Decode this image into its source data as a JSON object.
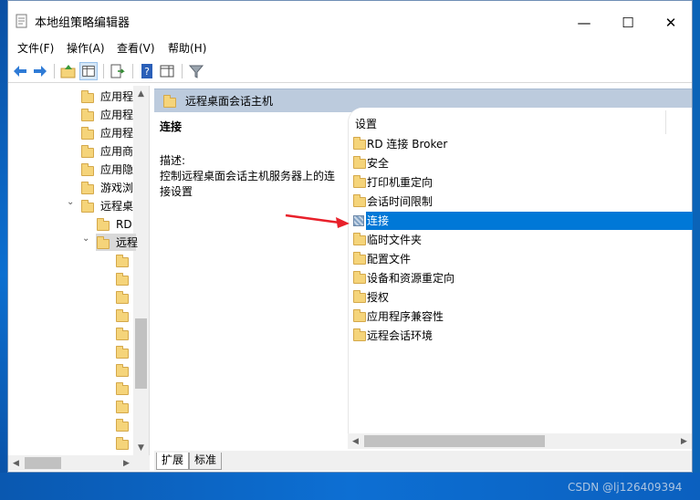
{
  "window": {
    "title": "本地组策略编辑器",
    "minimize_glyph": "—",
    "maximize_glyph": "☐",
    "close_glyph": "✕"
  },
  "menu": [
    "文件(F)",
    "操作(A)",
    "查看(V)",
    "帮助(H)"
  ],
  "toolbar": {
    "icons": [
      "back-icon",
      "forward-icon",
      "up-folder-icon",
      "show-hide-tree-icon",
      "export-list-icon",
      "help-icon",
      "show-hide-action-pane-icon",
      "filter-icon"
    ]
  },
  "tree": {
    "items": [
      {
        "label": "应用程",
        "indent": 1,
        "expand": ""
      },
      {
        "label": "应用程",
        "indent": 1,
        "expand": ""
      },
      {
        "label": "应用程",
        "indent": 1,
        "expand": ""
      },
      {
        "label": "应用商",
        "indent": 1,
        "expand": ""
      },
      {
        "label": "应用隐",
        "indent": 1,
        "expand": ""
      },
      {
        "label": "游戏浏",
        "indent": 1,
        "expand": ""
      },
      {
        "label": "远程桌",
        "indent": 1,
        "expand": "open"
      },
      {
        "label": "RD",
        "indent": 2,
        "expand": ""
      },
      {
        "label": "远程",
        "indent": 2,
        "expand": "open",
        "selected": true
      },
      {
        "label": "",
        "indent": 3,
        "expand": ""
      },
      {
        "label": "",
        "indent": 3,
        "expand": ""
      },
      {
        "label": "",
        "indent": 3,
        "expand": ""
      },
      {
        "label": "",
        "indent": 3,
        "expand": ""
      },
      {
        "label": "",
        "indent": 3,
        "expand": ""
      },
      {
        "label": "",
        "indent": 3,
        "expand": ""
      },
      {
        "label": "",
        "indent": 3,
        "expand": ""
      },
      {
        "label": "",
        "indent": 3,
        "expand": ""
      },
      {
        "label": "",
        "indent": 3,
        "expand": ""
      },
      {
        "label": "",
        "indent": 3,
        "expand": ""
      },
      {
        "label": "",
        "indent": 3,
        "expand": ""
      }
    ]
  },
  "pane": {
    "header": "远程桌面会话主机",
    "desc_title": "连接",
    "desc_label": "描述:",
    "desc_text": "控制远程桌面会话主机服务器上的连接设置",
    "column_header": "设置",
    "items": [
      {
        "label": "RD 连接 Broker",
        "selected": false
      },
      {
        "label": "安全",
        "selected": false
      },
      {
        "label": "打印机重定向",
        "selected": false
      },
      {
        "label": "会话时间限制",
        "selected": false
      },
      {
        "label": "连接",
        "selected": true
      },
      {
        "label": "临时文件夹",
        "selected": false
      },
      {
        "label": "配置文件",
        "selected": false
      },
      {
        "label": "设备和资源重定向",
        "selected": false
      },
      {
        "label": "授权",
        "selected": false
      },
      {
        "label": "应用程序兼容性",
        "selected": false
      },
      {
        "label": "远程会话环境",
        "selected": false
      }
    ],
    "tabs": [
      "扩展",
      "标准"
    ]
  },
  "annotation": {
    "color": "#e8202a"
  },
  "watermark": "CSDN @lj126409394"
}
